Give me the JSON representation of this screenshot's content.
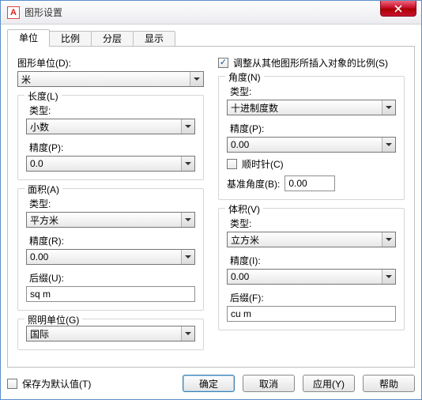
{
  "window": {
    "title": "图形设置",
    "app_icon_letter": "A"
  },
  "tabs": {
    "t0": "单位",
    "t1": "比例",
    "t2": "分层",
    "t3": "显示"
  },
  "drawing_units": {
    "label": "图形单位(D):",
    "value": "米"
  },
  "scale_insert": {
    "label": "调整从其他图形所插入对象的比例(S)"
  },
  "length": {
    "legend": "长度(L)",
    "type_label": "类型:",
    "type_value": "小数",
    "prec_label": "精度(P):",
    "prec_value": "0.0"
  },
  "angle": {
    "legend": "角度(N)",
    "type_label": "类型:",
    "type_value": "十进制度数",
    "prec_label": "精度(P):",
    "prec_value": "0.00",
    "clockwise_label": "顺时针(C)",
    "base_label": "基准角度(B):",
    "base_value": "0.00"
  },
  "area": {
    "legend": "面积(A)",
    "type_label": "类型:",
    "type_value": "平方米",
    "prec_label": "精度(R):",
    "prec_value": "0.00",
    "suffix_label": "后缀(U):",
    "suffix_value": "sq m"
  },
  "volume": {
    "legend": "体积(V)",
    "type_label": "类型:",
    "type_value": "立方米",
    "prec_label": "精度(I):",
    "prec_value": "0.00",
    "suffix_label": "后缀(F):",
    "suffix_value": "cu m"
  },
  "lighting": {
    "legend": "照明单位(G)",
    "value": "国际"
  },
  "footer": {
    "save_default": "保存为默认值(T)",
    "ok": "确定",
    "cancel": "取消",
    "apply": "应用(Y)",
    "help": "帮助"
  }
}
